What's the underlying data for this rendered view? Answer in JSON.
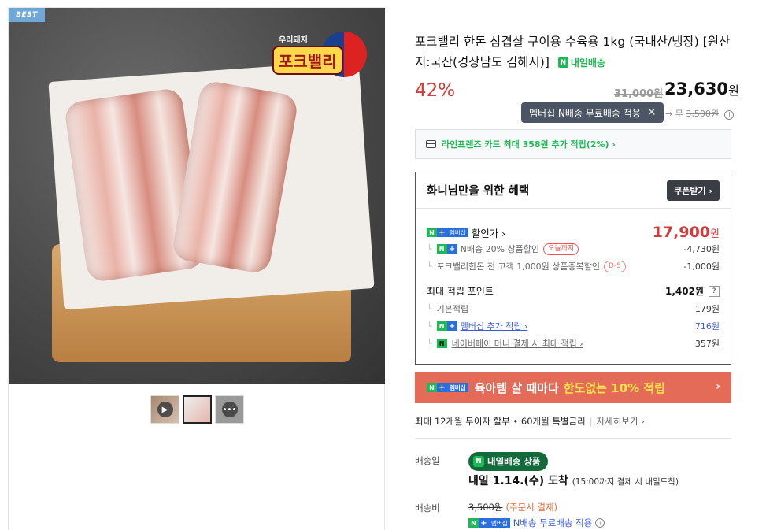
{
  "gallery": {
    "badge": "BEST",
    "logo_small": "우리돼지",
    "logo_main": "포크밸리",
    "thumbs": [
      {
        "name": "video",
        "icon": "play-icon"
      },
      {
        "name": "photo",
        "icon": ""
      },
      {
        "name": "more",
        "icon": "chat-icon"
      }
    ]
  },
  "product": {
    "title": "포크밸리 한돈 삼겹살 구이용 수육용 1kg (국내산/냉장) [원산지:국산(경상남도 김해시)]",
    "nday_label": "내일배송",
    "discount": "42%",
    "original_price": "31,000원",
    "price_value": "23,630",
    "price_unit": "원",
    "tooltip": "멤버십 N배송 무료배송 적용",
    "ship_prefix": "→ 무",
    "ship_strike": "3,500원"
  },
  "card_promo": "라인프렌즈 카드 최대 358원 추가 적립(2%) ›",
  "benefit": {
    "heading": "화니님만을 위한 혜택",
    "coupon_button": "쿠폰받기 ›",
    "sale_label": "할인가 ›",
    "sale_value": "17,900",
    "sale_unit": "원",
    "discounts": [
      {
        "label": "N배송 20% 상품할인",
        "pill": "오늘까지",
        "value": "-4,730원"
      },
      {
        "label": "포크밸리한돈 전 고객 1,000원 상품중복할인",
        "pill": "D-5",
        "value": "-1,000원"
      }
    ],
    "points_label": "최대 적립 포인트",
    "points_value": "1,402원",
    "points_rows": [
      {
        "label": "기본적립",
        "value": "179원"
      },
      {
        "label": "멤버십 추가 적립 ›",
        "value": "716원"
      },
      {
        "label": "네이버페이 머니 결제 시 최대 적립 ›",
        "value": "357원"
      }
    ]
  },
  "banner": {
    "text": "육아템 살 때마다",
    "highlight": "한도없는 10% 적립",
    "chev": "›"
  },
  "installment": {
    "text": "최대 12개월 무이자 할부 • 60개월 특별금리",
    "more": "자세히보기 ›"
  },
  "delivery": {
    "date_label": "배송일",
    "tag": "내일배송 상품",
    "arrive": "내일 1.14.(수) 도착",
    "arrive_note": "(15:00까지 결제 시 내일도착)",
    "fee_label": "배송비",
    "fee_strike": "3,500원",
    "fee_note": "(주문시 결제)",
    "free_ship": "N배송 무료배송 적용"
  },
  "colors": {
    "discount_red": "#d43b3b",
    "naver_green": "#1eb954",
    "banner": "#e46b58",
    "membership_blue": "#2a6fdb"
  }
}
